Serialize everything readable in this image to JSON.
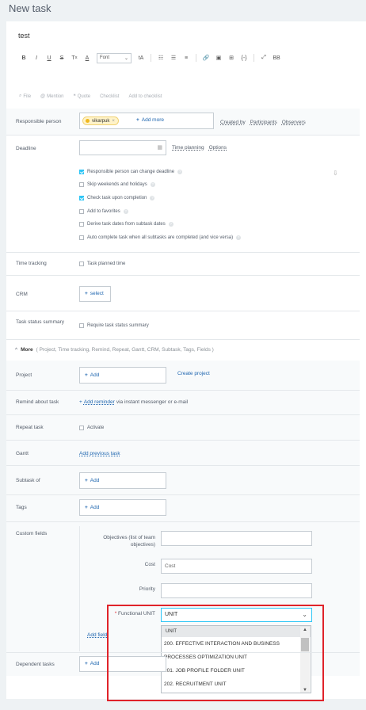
{
  "page": {
    "title": "New task"
  },
  "task": {
    "name": "test"
  },
  "toolbar": {
    "font_label": "Font",
    "buttons": [
      "B",
      "I",
      "U",
      "S",
      "Tx",
      "A",
      "tA",
      "ol",
      "ul",
      "align",
      "link",
      "image",
      "table",
      "code",
      "fullscreen",
      "bb"
    ]
  },
  "attachments": {
    "file": "File",
    "mention": "Mention",
    "quote": "Quote",
    "checklist": "Checklist",
    "add_to_checklist": "Add to checklist"
  },
  "responsible": {
    "label": "Responsible person",
    "user": "vikarpuk",
    "add_more": "Add more",
    "created_by": "Created by",
    "participants": "Participants",
    "observers": "Observers"
  },
  "deadline": {
    "label": "Deadline",
    "value": "",
    "time_planning": "Time planning",
    "options": "Options",
    "checkboxes": [
      {
        "label": "Responsible person can change deadline",
        "checked": true
      },
      {
        "label": "Skip weekends and holidays",
        "checked": false
      },
      {
        "label": "Check task upon completion",
        "checked": true
      },
      {
        "label": "Add to favorites",
        "checked": false
      },
      {
        "label": "Derive task dates from subtask dates",
        "checked": false
      },
      {
        "label": "Auto complete task when all subtasks are completed (and vice versa)",
        "checked": false
      }
    ]
  },
  "time_tracking": {
    "label": "Time tracking",
    "checkbox": "Task planned time"
  },
  "crm": {
    "label": "CRM",
    "button": "select"
  },
  "status_summary": {
    "label": "Task status summary",
    "checkbox": "Require task status summary"
  },
  "more": {
    "label": "More",
    "details": "( Project,  Time tracking,  Remind,  Repeat,  Gantt,  CRM,  Subtask,  Tags,  Fields )"
  },
  "project": {
    "label": "Project",
    "button": "Add",
    "create": "Create project"
  },
  "remind": {
    "label": "Remind about task",
    "add_reminder": "Add reminder",
    "via": "via instant messenger or e-mail"
  },
  "repeat": {
    "label": "Repeat task",
    "checkbox": "Activate"
  },
  "gantt": {
    "label": "Gantt",
    "link": "Add previous task"
  },
  "subtask": {
    "label": "Subtask of",
    "button": "Add"
  },
  "tags": {
    "label": "Tags",
    "button": "Add"
  },
  "custom_fields": {
    "label": "Custom fields",
    "objectives_label": "Objectives (list of team objectives)",
    "objectives_value": "",
    "cost_label": "Cost",
    "cost_placeholder": "Cost",
    "priority_label": "Priority",
    "priority_value": "",
    "functional_unit_required": "*",
    "functional_unit_label": "Functional UNIT",
    "functional_unit_value": "UNIT",
    "add_field": "Add field",
    "options": [
      "UNIT",
      "200. EFFECTIVE INTERACTION AND BUSINESS",
      "PROCESSES OPTIMIZATION UNIT",
      "201. JOB PROFILE FOLDER UNIT",
      "202. RECRUITMENT UNIT"
    ]
  },
  "dependent": {
    "label": "Dependent tasks",
    "button": "Add"
  },
  "colors": {
    "accent": "#2067b0",
    "highlight": "#e0232a",
    "check": "#2fc6f6"
  }
}
